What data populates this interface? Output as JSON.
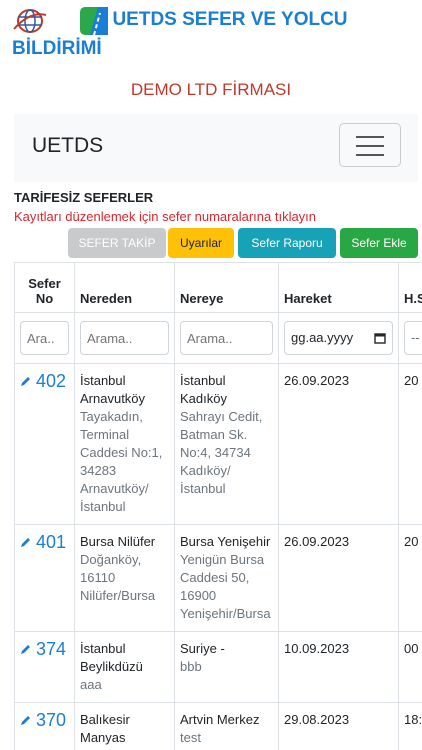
{
  "header": {
    "title_line1": "UETDS SEFER VE YOLCU",
    "title_line2": "BİLDİRİMİ",
    "company": "DEMO LTD FİRMASI"
  },
  "navbar": {
    "brand": "UETDS"
  },
  "section": {
    "title": "TARİFESİZ SEFERLER",
    "hint": "Kayıtları düzenlemek için sefer numaralarına tıklayın"
  },
  "buttons": {
    "sefer_takip": "SEFER TAKİP",
    "uyarilar": "Uyarılar",
    "sefer_raporu": "Sefer Raporu",
    "sefer_ekle": "Sefer Ekle"
  },
  "table": {
    "headers": [
      "Sefer No",
      "Nereden",
      "Nereye",
      "Hareket",
      "H.S"
    ],
    "filters": {
      "sefer_no": "Ara..",
      "nereden": "Arama..",
      "nereye": "Arama..",
      "hareket": "gg.aa.yyyy",
      "hs": "--"
    },
    "rows": [
      {
        "no": "402",
        "from_city": "İstanbul Arnavutköy",
        "from_addr": "Tayakadın, Terminal Caddesi No:1, 34283 Arnavutköy/İstanbul",
        "to_city": "İstanbul Kadıköy",
        "to_addr": "Sahrayı Cedit, Batman Sk. No:4, 34734 Kadıköy/İstanbul",
        "date": "26.09.2023",
        "hs": "20"
      },
      {
        "no": "401",
        "from_city": "Bursa Nilüfer",
        "from_addr": "Doğanköy, 16110 Nilüfer/Bursa",
        "to_city": "Bursa Yenişehir",
        "to_addr": "Yenigün Bursa Caddesi 50, 16900 Yenişehir/Bursa",
        "date": "26.09.2023",
        "hs": "20"
      },
      {
        "no": "374",
        "from_city": "İstanbul Beylikdüzü",
        "from_addr": "aaa",
        "to_city": "Suriye -",
        "to_addr": "bbb",
        "date": "10.09.2023",
        "hs": "00"
      },
      {
        "no": "370",
        "from_city": "Balıkesir Manyas",
        "from_addr": "test",
        "to_city": "Artvin Merkez",
        "to_addr": "test",
        "date": "29.08.2023",
        "hs": "18:"
      }
    ]
  },
  "colors": {
    "title_blue": "#1a7fd4",
    "company_red": "#c0392b",
    "btn_gray": "#c8cacc",
    "btn_yellow": "#ffc107",
    "btn_teal": "#17a2b8",
    "btn_green": "#28a745"
  },
  "icons": [
    "globe-logo-icon",
    "road-logo-icon",
    "hamburger-icon",
    "pencil-icon",
    "calendar-icon"
  ]
}
